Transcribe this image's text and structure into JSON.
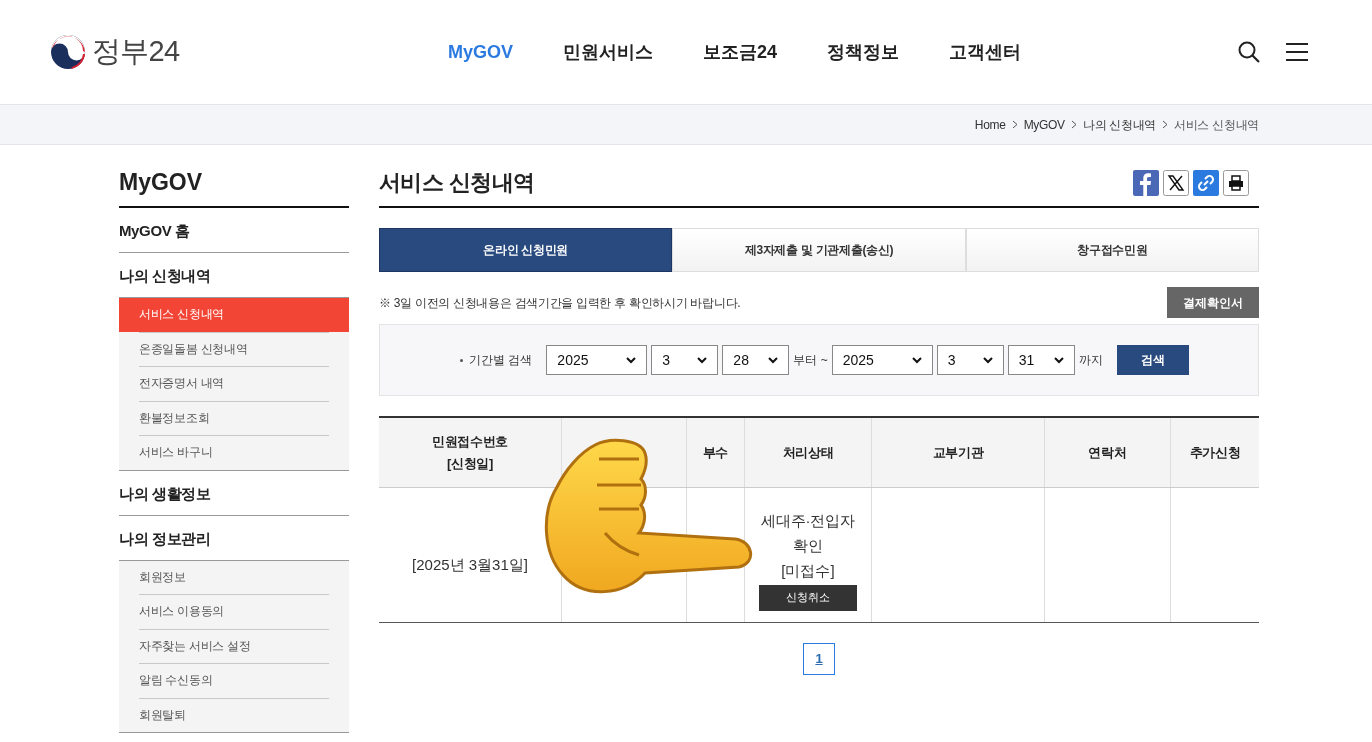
{
  "header": {
    "logo_text": "정부24",
    "nav": [
      {
        "label": "MyGOV",
        "selected": true
      },
      {
        "label": "민원서비스",
        "selected": false
      },
      {
        "label": "보조금24",
        "selected": false
      },
      {
        "label": "정책정보",
        "selected": false
      },
      {
        "label": "고객센터",
        "selected": false
      }
    ]
  },
  "breadcrumb": [
    "Home",
    "MyGOV",
    "나의 신청내역",
    "서비스 신청내역"
  ],
  "sidebar": {
    "title": "MyGOV",
    "sections": [
      {
        "label": "MyGOV 홈"
      },
      {
        "label": "나의 신청내역",
        "children": [
          {
            "label": "서비스 신청내역",
            "selected": true
          },
          {
            "label": "온종일돌봄 신청내역",
            "selected": false
          },
          {
            "label": "전자증명서 내역",
            "selected": false
          },
          {
            "label": "환불정보조회",
            "selected": false
          },
          {
            "label": "서비스 바구니",
            "selected": false
          }
        ]
      },
      {
        "label": "나의 생활정보"
      },
      {
        "label": "나의 정보관리",
        "children": [
          {
            "label": "회원정보",
            "selected": false
          },
          {
            "label": "서비스 이용동의",
            "selected": false
          },
          {
            "label": "자주찾는 서비스 설정",
            "selected": false
          },
          {
            "label": "알림 수신동의",
            "selected": false
          },
          {
            "label": "회원탈퇴",
            "selected": false
          }
        ]
      }
    ]
  },
  "main": {
    "title": "서비스 신청내역",
    "tabs": [
      {
        "label": "온라인 신청민원",
        "selected": true
      },
      {
        "label": "제3자제출 및 기관제출(송신)",
        "selected": false
      },
      {
        "label": "창구접수민원",
        "selected": false
      }
    ],
    "notice": "※ 3일 이전의 신청내용은 검색기간을 입력한 후 확인하시기 바랍니다.",
    "receipt_button": "결제확인서",
    "search": {
      "label": "기간별 검색",
      "from": [
        "2025",
        "3",
        "28"
      ],
      "from_suffix": "부터 ~",
      "to": [
        "2025",
        "3",
        "31"
      ],
      "to_suffix": "까지",
      "button": "검색"
    },
    "table": {
      "columns": [
        {
          "lines": [
            "민원접수번호",
            "[신청일]"
          ]
        },
        {},
        {
          "lines": [
            "부수"
          ]
        },
        {
          "lines": [
            "처리상태"
          ]
        },
        {
          "lines": [
            "교부기관"
          ]
        },
        {
          "lines": [
            "연락처"
          ]
        },
        {
          "lines": [
            "추가신청"
          ]
        }
      ],
      "rows": [
        {
          "date": "[2025년 3월31일]",
          "status": [
            "세대주·전입자",
            "확인",
            "[미접수]"
          ],
          "cancel_button": "신청취소"
        }
      ]
    },
    "pagination": [
      {
        "label": "1",
        "selected": true
      }
    ]
  }
}
